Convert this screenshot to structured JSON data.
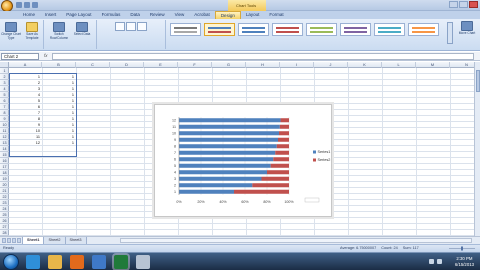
{
  "window": {
    "title": "Chart Tools"
  },
  "tabs": [
    "Home",
    "Insert",
    "Page Layout",
    "Formulas",
    "Data",
    "Review",
    "View",
    "Acrobat",
    "Design",
    "Layout",
    "Format"
  ],
  "active_tab": "Design",
  "ribbon": {
    "buttons": [
      {
        "label": "Change Chart Type"
      },
      {
        "label": "Save As Template"
      },
      {
        "label": "Switch Row/Column"
      },
      {
        "label": "Select Data"
      }
    ],
    "move_chart": "Move Chart"
  },
  "formula_bar": {
    "name_box": "Chart 2",
    "fx": "fx",
    "value": ""
  },
  "columns": [
    "A",
    "B",
    "C",
    "D",
    "E",
    "F",
    "G",
    "H",
    "I",
    "J",
    "K",
    "L",
    "M",
    "N"
  ],
  "rows": [
    "1",
    "2",
    "3",
    "4",
    "5",
    "6",
    "7",
    "8",
    "9",
    "10",
    "11",
    "12",
    "13",
    "14",
    "15",
    "16",
    "17",
    "18",
    "19",
    "20",
    "21",
    "22",
    "23",
    "24",
    "25",
    "26",
    "27",
    "28"
  ],
  "cells": {
    "col_a": [
      "1",
      "2",
      "3",
      "4",
      "5",
      "6",
      "7",
      "8",
      "9",
      "10",
      "11",
      "12"
    ],
    "col_b": [
      "1",
      "1",
      "1",
      "1",
      "1",
      "1",
      "1",
      "1",
      "1",
      "1",
      "1",
      "1"
    ]
  },
  "chart_data": {
    "type": "bar",
    "stacked": "100%",
    "orientation": "horizontal",
    "categories": [
      "1",
      "2",
      "3",
      "4",
      "5",
      "6",
      "7",
      "8",
      "9",
      "10",
      "11",
      "12"
    ],
    "series": [
      {
        "name": "Series1",
        "values": [
          1,
          2,
          3,
          4,
          5,
          6,
          7,
          8,
          9,
          10,
          11,
          12
        ],
        "color": "#4f81bd"
      },
      {
        "name": "Series2",
        "values": [
          1,
          1,
          1,
          1,
          1,
          1,
          1,
          1,
          1,
          1,
          1,
          1
        ],
        "color": "#c0504d"
      }
    ],
    "x_ticks": [
      "0%",
      "20%",
      "40%",
      "60%",
      "80%",
      "100%"
    ],
    "xlim": [
      0,
      100
    ],
    "legend": "right"
  },
  "sheet_tabs": [
    "Sheet1",
    "Sheet2",
    "Sheet3"
  ],
  "active_sheet": "Sheet1",
  "status": {
    "mode": "Ready",
    "average": "Average: 6.75000007",
    "count": "Count: 24",
    "sum": "Sum: 117"
  },
  "taskbar": {
    "time": "2:30 PM",
    "date": "6/15/2013"
  }
}
